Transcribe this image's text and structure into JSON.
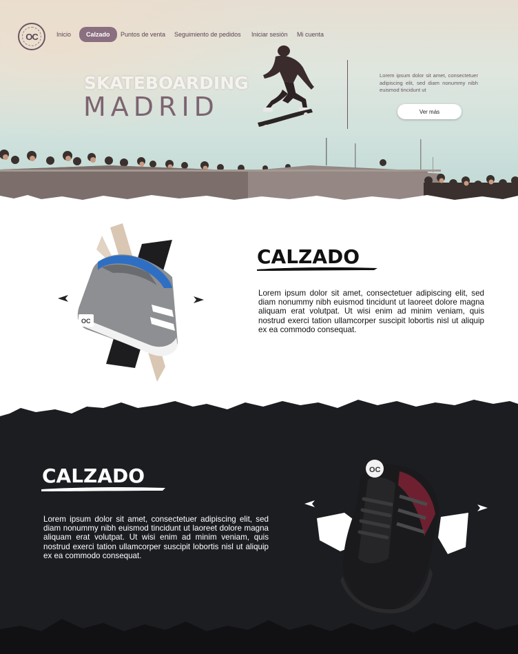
{
  "brand": {
    "logo_text": "OC",
    "logo_icon": "oc-circle-logo"
  },
  "nav": {
    "items": [
      {
        "label": "Inicio"
      },
      {
        "label": "Calzado"
      },
      {
        "label": "Puntos de venta"
      },
      {
        "label": "Seguimiento de  pedidos"
      },
      {
        "label": "Iniciar sesión"
      },
      {
        "label": "Mi cuenta"
      }
    ],
    "active_index": 1
  },
  "hero": {
    "title_line1": "SKATEBOARDING",
    "title_line2": "MADRID",
    "text": "Lorem ipsum dolor sit amet, consectetuer adipiscing elit, sed diam nonummy nibh euismod tincidunt ut",
    "button_label": "Ver más"
  },
  "section_light": {
    "title": "CALZADO",
    "text": "Lorem ipsum dolor sit amet, consectetuer adipiscing elit, sed diam nonummy nibh euismod tincidunt ut laoreet dolore magna aliquam erat volutpat. Ut wisi enim ad minim veniam, quis nostrud exerci tation ullamcorper suscipit lobortis nisl ut aliquip ex ea commodo consequat.",
    "product_badge": "OC"
  },
  "section_dark": {
    "title": "CALZADO",
    "text": "Lorem ipsum dolor sit amet, consectetuer adipiscing elit, sed diam nonummy nibh euismod tincidunt ut laoreet dolore magna aliquam erat volutpat. Ut wisi enim ad minim veniam, quis nostrud exerci tation ullamcorper suscipit lobortis nisl ut aliquip ex ea commodo consequat.",
    "product_badge": "OC"
  },
  "colors": {
    "accent": "#8a6f80",
    "dark_bg": "#1c1d21",
    "title_purple": "#7c6470",
    "brush_beige": "#d9c7b3"
  }
}
